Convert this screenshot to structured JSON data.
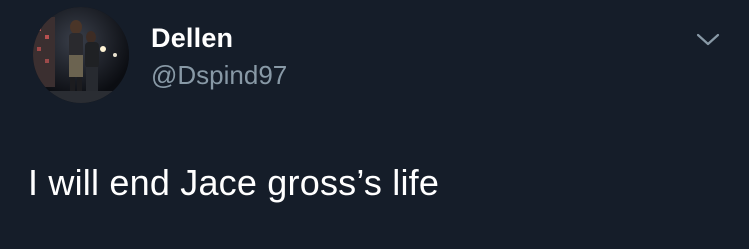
{
  "tweet": {
    "author": {
      "display_name": "Dellen",
      "handle": "@Dspind97"
    },
    "text": "I will end Jace gross’s life",
    "menu_icon": "chevron-down-icon",
    "avatar_icon": "profile-photo"
  },
  "colors": {
    "background": "#151d29",
    "primary_text": "#ffffff",
    "secondary_text": "#8899a6"
  }
}
